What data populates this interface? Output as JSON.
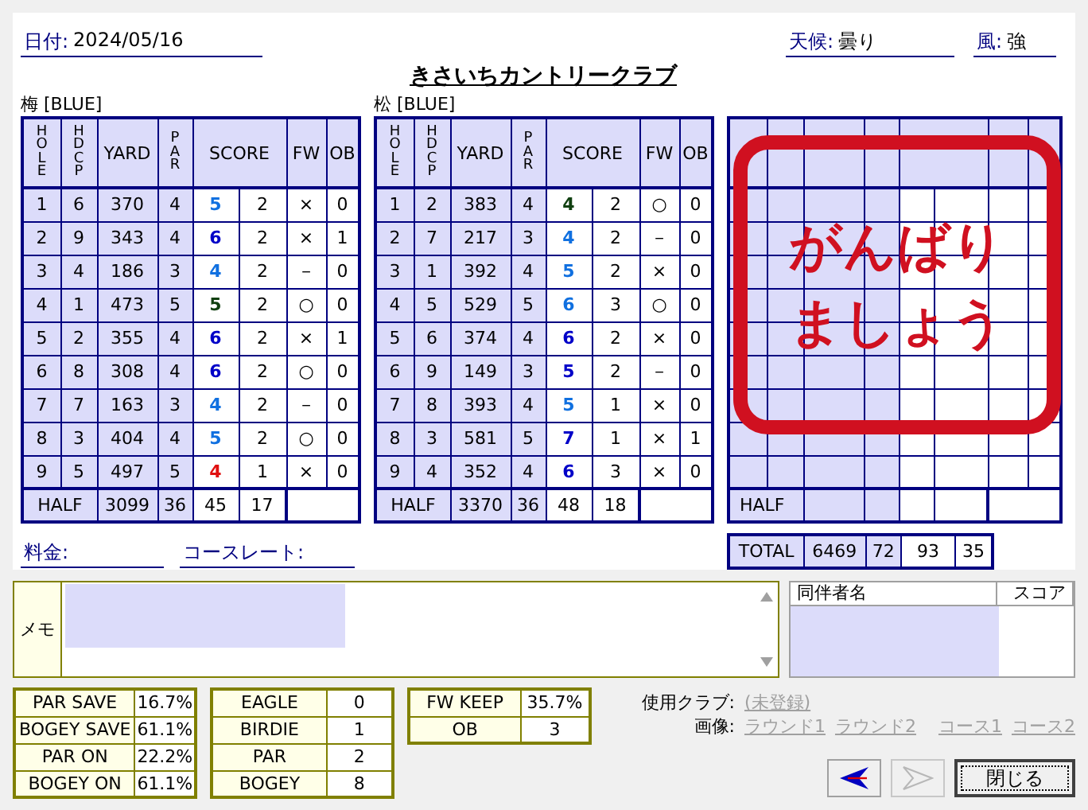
{
  "date": {
    "label": "日付:",
    "value": "2024/05/16"
  },
  "weather": {
    "label": "天候:",
    "value": "曇り"
  },
  "wind": {
    "label": "風:",
    "value": "強"
  },
  "course_name": "きさいちカントリークラブ",
  "nines": [
    {
      "title": "梅 [BLUE]",
      "columns": [
        "HOLE",
        "HDCP",
        "YARD",
        "PAR",
        "SCORE",
        "FW",
        "OB"
      ],
      "holes": [
        {
          "hole": "1",
          "hdcp": "6",
          "yard": "370",
          "par": "4",
          "score": "5",
          "color": "#1070e0",
          "putts": "2",
          "fw": "×",
          "ob": "0"
        },
        {
          "hole": "2",
          "hdcp": "9",
          "yard": "343",
          "par": "4",
          "score": "6",
          "color": "#0000c8",
          "putts": "2",
          "fw": "×",
          "ob": "1"
        },
        {
          "hole": "3",
          "hdcp": "4",
          "yard": "186",
          "par": "3",
          "score": "4",
          "color": "#1070e0",
          "putts": "2",
          "fw": "－",
          "ob": "0"
        },
        {
          "hole": "4",
          "hdcp": "1",
          "yard": "473",
          "par": "5",
          "score": "5",
          "color": "#104010",
          "putts": "2",
          "fw": "○",
          "ob": "0"
        },
        {
          "hole": "5",
          "hdcp": "2",
          "yard": "355",
          "par": "4",
          "score": "6",
          "color": "#0000c8",
          "putts": "2",
          "fw": "×",
          "ob": "1"
        },
        {
          "hole": "6",
          "hdcp": "8",
          "yard": "308",
          "par": "4",
          "score": "6",
          "color": "#0000c8",
          "putts": "2",
          "fw": "○",
          "ob": "0"
        },
        {
          "hole": "7",
          "hdcp": "7",
          "yard": "163",
          "par": "3",
          "score": "4",
          "color": "#1070e0",
          "putts": "2",
          "fw": "－",
          "ob": "0"
        },
        {
          "hole": "8",
          "hdcp": "3",
          "yard": "404",
          "par": "4",
          "score": "5",
          "color": "#1070e0",
          "putts": "2",
          "fw": "○",
          "ob": "0"
        },
        {
          "hole": "9",
          "hdcp": "5",
          "yard": "497",
          "par": "5",
          "score": "4",
          "color": "#e01010",
          "putts": "1",
          "fw": "×",
          "ob": "0"
        }
      ],
      "half": {
        "label": "HALF",
        "yard": "3099",
        "par": "36",
        "score": "45",
        "putts": "17"
      }
    },
    {
      "title": "松 [BLUE]",
      "columns": [
        "HOLE",
        "HDCP",
        "YARD",
        "PAR",
        "SCORE",
        "FW",
        "OB"
      ],
      "holes": [
        {
          "hole": "1",
          "hdcp": "2",
          "yard": "383",
          "par": "4",
          "score": "4",
          "color": "#104010",
          "putts": "2",
          "fw": "○",
          "ob": "0"
        },
        {
          "hole": "2",
          "hdcp": "7",
          "yard": "217",
          "par": "3",
          "score": "4",
          "color": "#1070e0",
          "putts": "2",
          "fw": "－",
          "ob": "0"
        },
        {
          "hole": "3",
          "hdcp": "1",
          "yard": "392",
          "par": "4",
          "score": "5",
          "color": "#1070e0",
          "putts": "2",
          "fw": "×",
          "ob": "0"
        },
        {
          "hole": "4",
          "hdcp": "5",
          "yard": "529",
          "par": "5",
          "score": "6",
          "color": "#1070e0",
          "putts": "3",
          "fw": "○",
          "ob": "0"
        },
        {
          "hole": "5",
          "hdcp": "6",
          "yard": "374",
          "par": "4",
          "score": "6",
          "color": "#0000c8",
          "putts": "2",
          "fw": "×",
          "ob": "0"
        },
        {
          "hole": "6",
          "hdcp": "9",
          "yard": "149",
          "par": "3",
          "score": "5",
          "color": "#0000c8",
          "putts": "2",
          "fw": "－",
          "ob": "0"
        },
        {
          "hole": "7",
          "hdcp": "8",
          "yard": "393",
          "par": "4",
          "score": "5",
          "color": "#1070e0",
          "putts": "1",
          "fw": "×",
          "ob": "0"
        },
        {
          "hole": "8",
          "hdcp": "3",
          "yard": "581",
          "par": "5",
          "score": "7",
          "color": "#0000c8",
          "putts": "1",
          "fw": "×",
          "ob": "1"
        },
        {
          "hole": "9",
          "hdcp": "4",
          "yard": "352",
          "par": "4",
          "score": "6",
          "color": "#0000c8",
          "putts": "3",
          "fw": "×",
          "ob": "0"
        }
      ],
      "half": {
        "label": "HALF",
        "yard": "3370",
        "par": "36",
        "score": "48",
        "putts": "18"
      }
    }
  ],
  "empty_card": {
    "half_label": "HALF",
    "stamp": [
      "がんばり",
      "ましょう"
    ]
  },
  "total": {
    "label": "TOTAL",
    "yard": "6469",
    "par": "72",
    "score": "93",
    "putts": "35"
  },
  "fee": {
    "label": "料金:"
  },
  "course_rate": {
    "label": "コースレート:"
  },
  "memo": {
    "label": "メモ"
  },
  "stats": [
    [
      {
        "label": "PAR SAVE",
        "value": "16.7%"
      },
      {
        "label": "BOGEY SAVE",
        "value": "61.1%"
      },
      {
        "label": "PAR ON",
        "value": "22.2%"
      },
      {
        "label": "BOGEY ON",
        "value": "61.1%"
      }
    ],
    [
      {
        "label": "EAGLE",
        "value": "0"
      },
      {
        "label": "BIRDIE",
        "value": "1"
      },
      {
        "label": "PAR",
        "value": "2"
      },
      {
        "label": "BOGEY",
        "value": "8"
      }
    ],
    [
      {
        "label": "FW KEEP",
        "value": "35.7%"
      },
      {
        "label": "OB",
        "value": "3"
      }
    ]
  ],
  "companions": {
    "columns": [
      "同伴者名",
      "スコア"
    ]
  },
  "clubs": {
    "label": "使用クラブ:",
    "link": "(未登録)"
  },
  "images": {
    "label": "画像:",
    "links": [
      "ラウンド1",
      "ラウンド2",
      "コース1",
      "コース2"
    ]
  },
  "buttons": {
    "prev": {
      "disabled": false
    },
    "next": {
      "disabled": true
    },
    "close": {
      "label": "閉じる"
    }
  }
}
